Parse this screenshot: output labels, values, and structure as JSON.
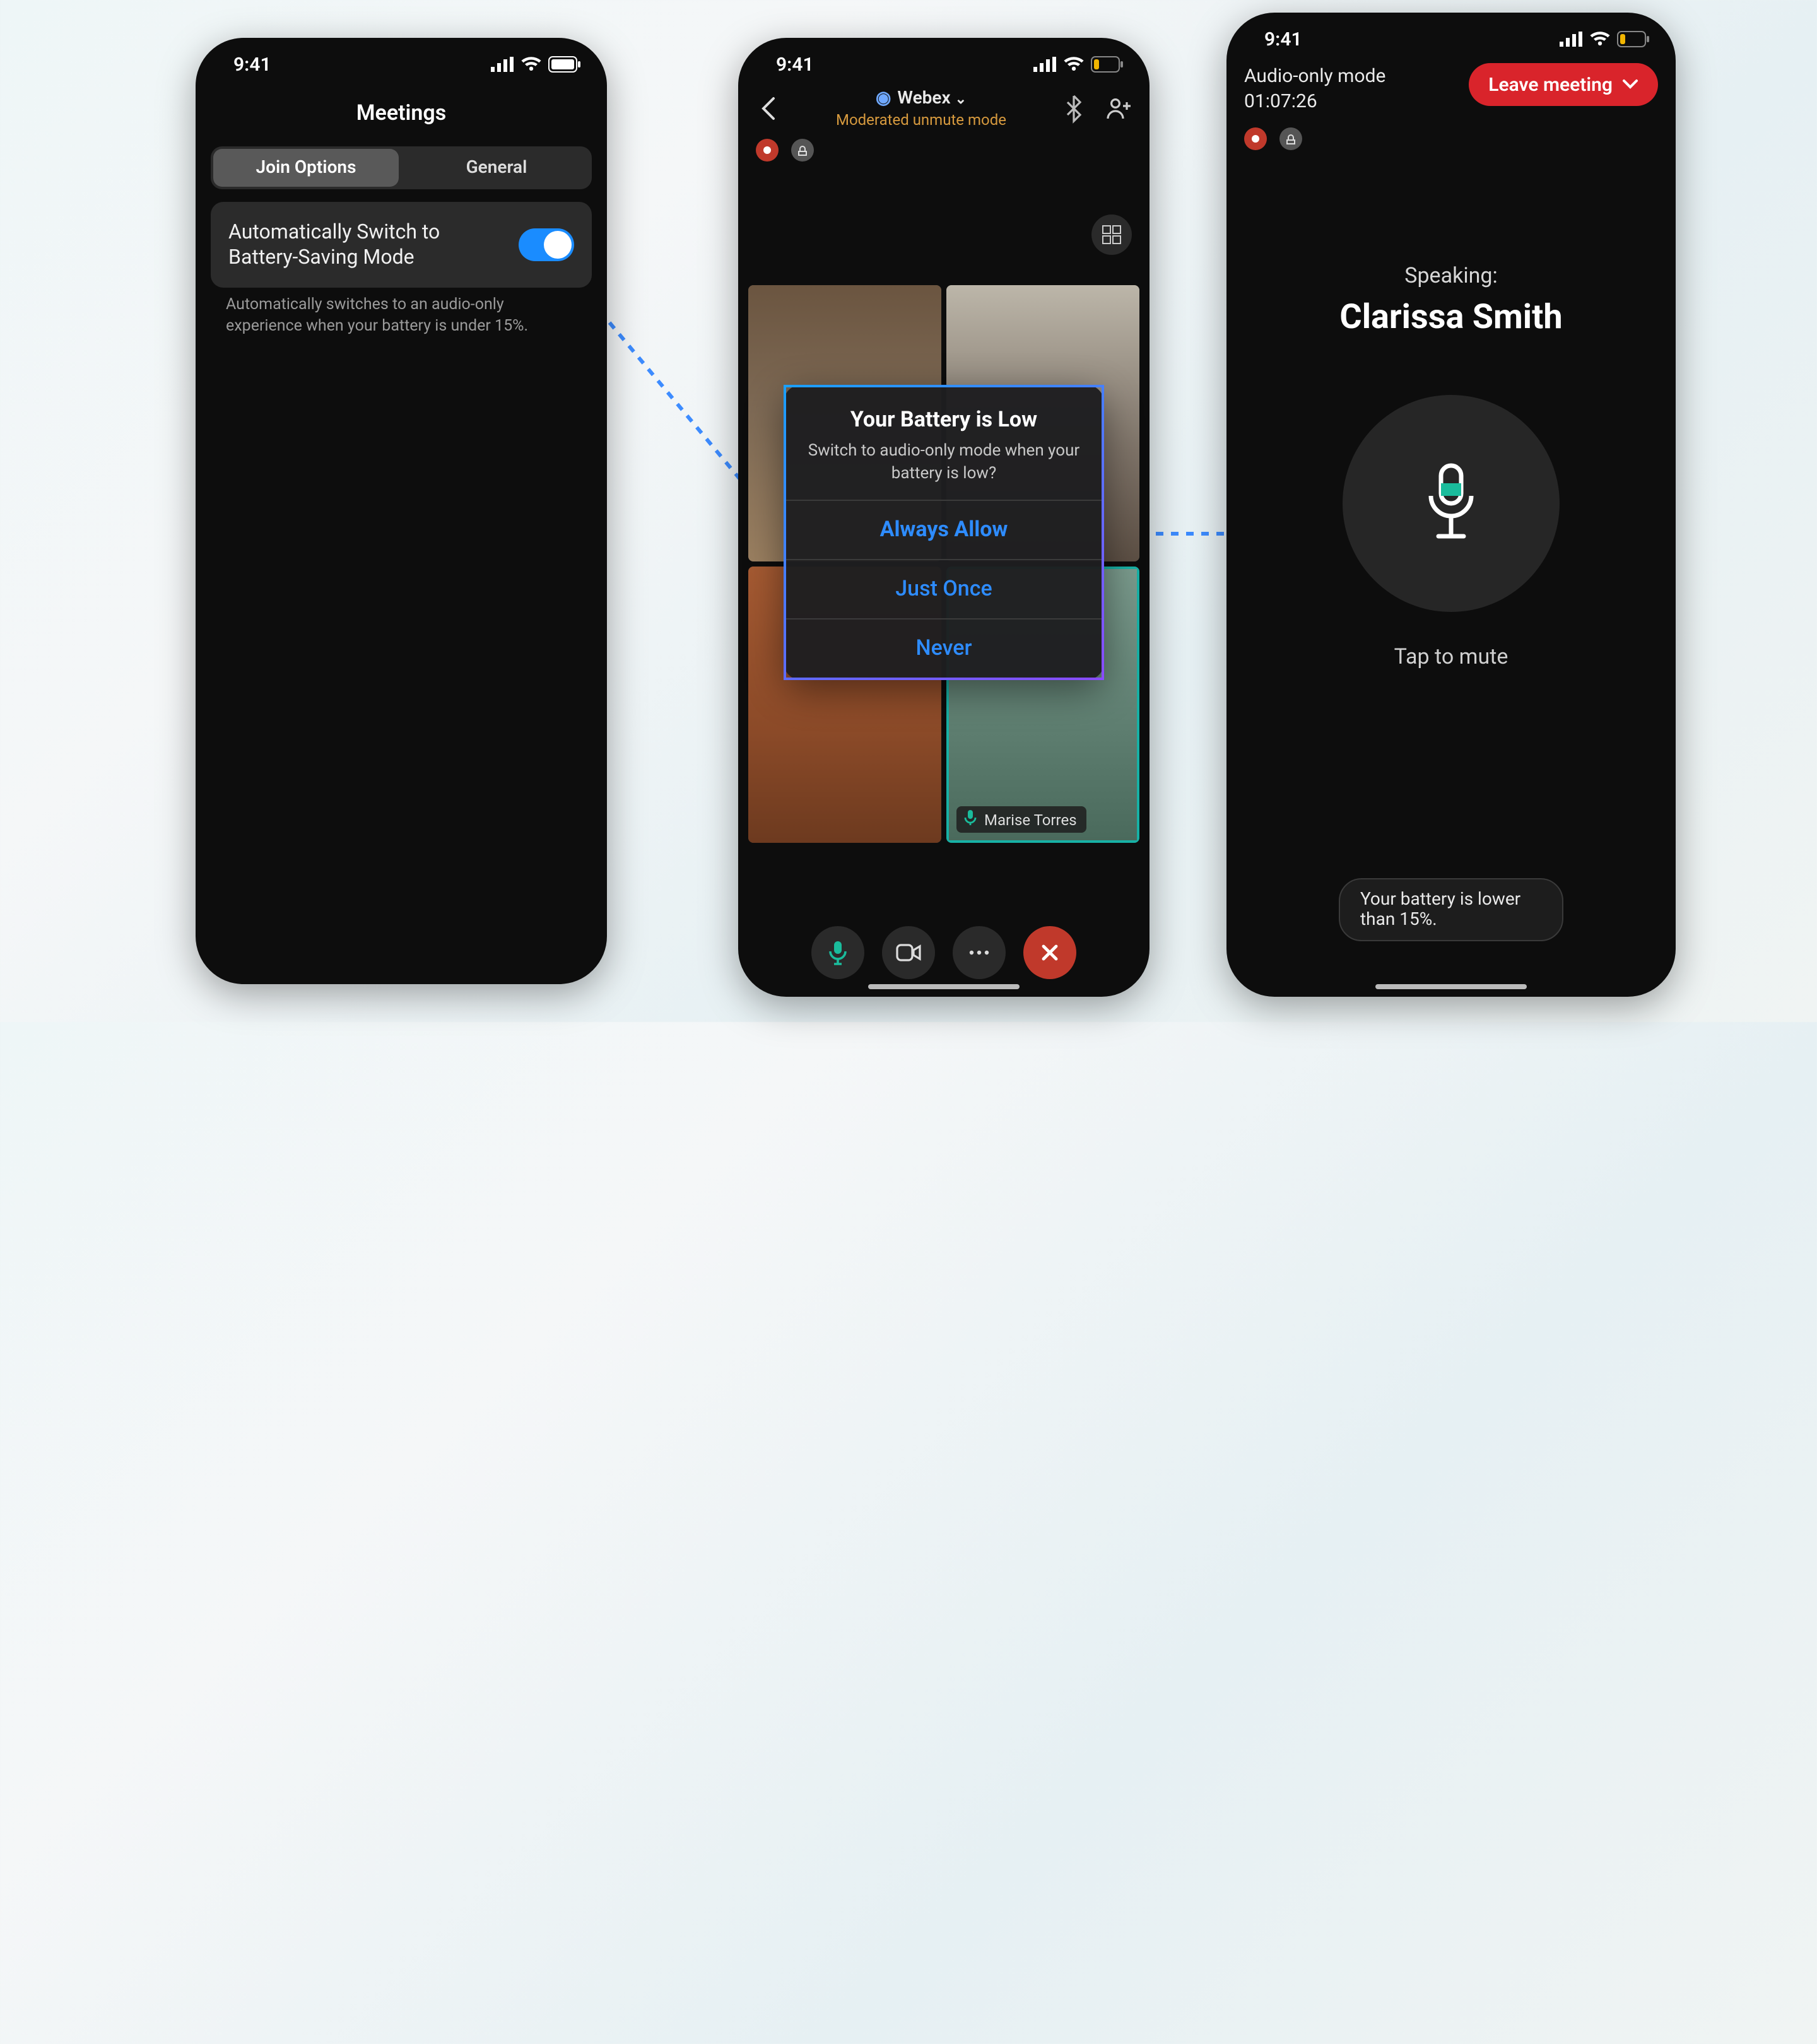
{
  "status": {
    "time": "9:41"
  },
  "phone1": {
    "header": "Meetings",
    "tabs": {
      "join": "Join Options",
      "general": "General"
    },
    "setting": {
      "label": "Automatically Switch to Battery-Saving Mode",
      "description": "Automatically switches to an audio-only experience when your battery is under 15%."
    }
  },
  "phone2": {
    "title": "Webex",
    "subtitle": "Moderated unmute mode",
    "participant_name": "Marise Torres",
    "dialog": {
      "title": "Your Battery is Low",
      "subtitle": "Switch to audio-only mode when your battery is low?",
      "opt_always": "Always Allow",
      "opt_once": "Just Once",
      "opt_never": "Never"
    }
  },
  "phone3": {
    "mode_label": "Audio-only mode",
    "elapsed": "01:07:26",
    "leave_label": "Leave meeting",
    "speaking_label": "Speaking:",
    "speaker_name": "Clarissa Smith",
    "tap_to_mute": "Tap to mute",
    "toast": "Your battery is lower than 15%."
  }
}
